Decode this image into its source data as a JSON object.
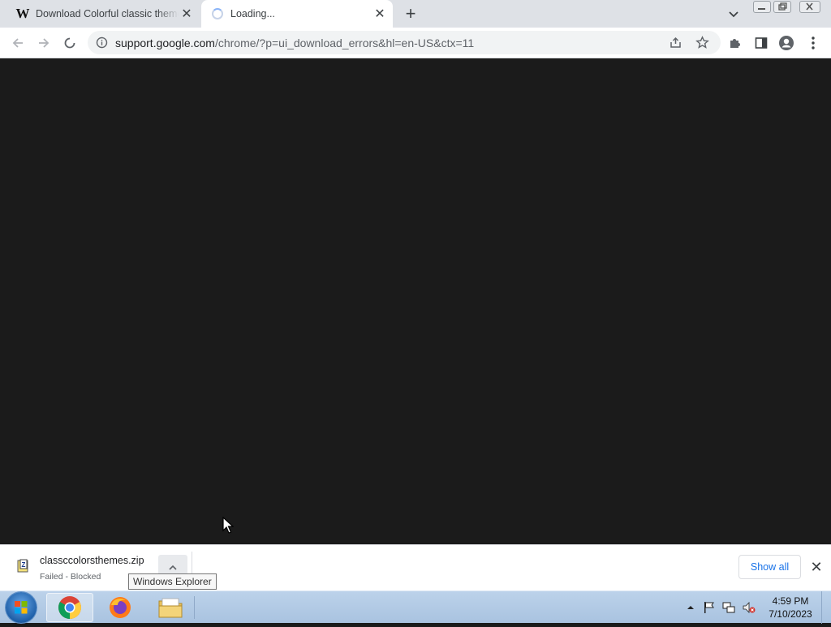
{
  "tabs": [
    {
      "title": "Download Colorful classic theme",
      "favicon": "w-logo-icon"
    },
    {
      "title": "Loading...",
      "favicon": "loading-spinner-icon"
    }
  ],
  "tab_favicon_letter": "W",
  "address_bar": {
    "host": "support.google.com",
    "path": "/chrome/?p=ui_download_errors&hl=en-US&ctx=11"
  },
  "download": {
    "filename": "classccolorsthemes.zip",
    "status": "Failed - Blocked",
    "show_all_label": "Show all"
  },
  "tooltip": "Windows Explorer",
  "taskbar": {
    "time": "4:59 PM",
    "date": "7/10/2023"
  },
  "colors": {
    "content_bg": "#1b1b1b",
    "accent": "#1a73e8"
  }
}
